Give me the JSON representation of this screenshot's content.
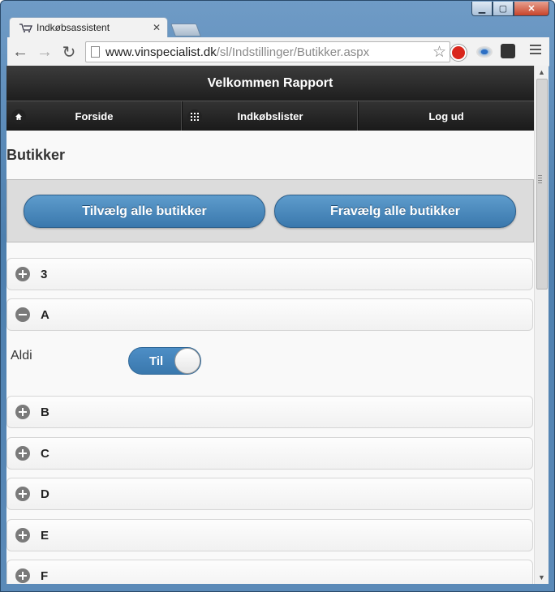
{
  "browser": {
    "tab_title": "Indkøbsassistent",
    "url_host": "www.vinspecialist.dk",
    "url_path": "/sl/Indstillinger/Butikker.aspx"
  },
  "page": {
    "header_title": "Velkommen Rapport",
    "nav": [
      {
        "label": "Forside",
        "icon": "home-icon"
      },
      {
        "label": "Indkøbslister",
        "icon": "grid-icon"
      },
      {
        "label": "Log ud",
        "icon": ""
      }
    ],
    "title": "Butikker",
    "buttons": {
      "select_all": "Tilvælg alle butikker",
      "deselect_all": "Fravælg alle butikker"
    },
    "groups": [
      {
        "label": "3",
        "expanded": false
      },
      {
        "label": "A",
        "expanded": true
      },
      {
        "label": "B",
        "expanded": false
      },
      {
        "label": "C",
        "expanded": false
      },
      {
        "label": "D",
        "expanded": false
      },
      {
        "label": "E",
        "expanded": false
      },
      {
        "label": "F",
        "expanded": false
      }
    ],
    "store": {
      "name": "Aldi",
      "toggle_label": "Til",
      "enabled": true
    }
  },
  "colors": {
    "accent": "#3a78ad",
    "header": "#1e1e1e"
  }
}
